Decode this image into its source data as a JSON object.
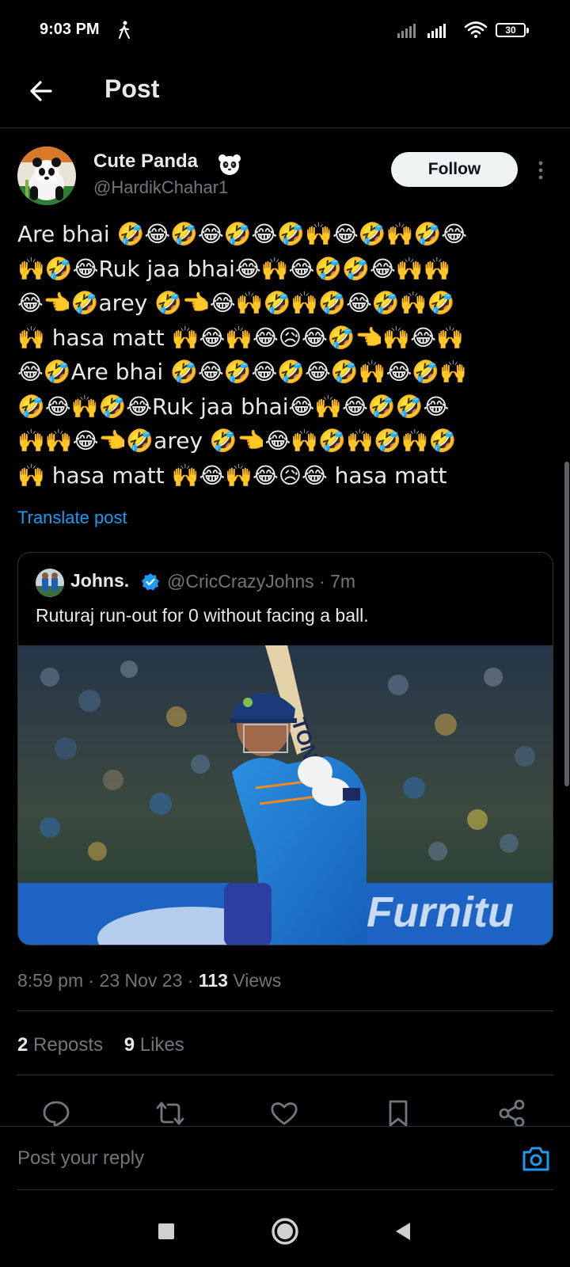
{
  "status_bar": {
    "time": "9:03 PM",
    "battery": "30"
  },
  "header": {
    "title": "Post"
  },
  "author": {
    "name": "Cute Panda",
    "handle": "@HardikChahar1",
    "follow_label": "Follow"
  },
  "post": {
    "lines": [
      "Are bhai 🤣😂🤣😂🤣😂🤣🙌😂🤣🙌🤣😂",
      "🙌🤣😂Ruk jaa bhai😂🙌😂🤣🤣😂🙌🙌",
      "😂👈🤣arey 🤣👈😂🙌🤣🙌🤣😂🤣🙌🤣",
      "🙌 hasa matt 🙌😂🙌😂😥😂🤣👈🙌😂🙌",
      "😂🤣Are bhai 🤣😂🤣😂🤣😂🤣🙌😂🤣🙌",
      "🤣😂🙌🤣😂Ruk jaa bhai😂🙌😂🤣🤣😂",
      "🙌🙌😂👈🤣arey 🤣👈😂🙌🤣🙌🤣🙌🤣",
      "🙌 hasa matt 🙌😂🙌😂😥😂 hasa matt"
    ],
    "translate_label": "Translate post",
    "time": "8:59 pm · 23 Nov 23 · ",
    "views_count": "113",
    "views_label": " Views"
  },
  "quote": {
    "name": "Johns.",
    "handle": "@CricCrazyJohns · 7m",
    "text": "Ruturaj run-out for 0 without facing a ball.",
    "media_text_bat": "TON",
    "media_text_board": "Furnitu"
  },
  "stats": {
    "reposts_count": "2",
    "reposts_label": " Reposts",
    "likes_count": "9",
    "likes_label": " Likes"
  },
  "reply": {
    "placeholder": "Post your reply"
  },
  "colors": {
    "accent": "#1d9bf0",
    "background": "#000000",
    "text": "#e7e9ea",
    "muted": "#71767b"
  }
}
